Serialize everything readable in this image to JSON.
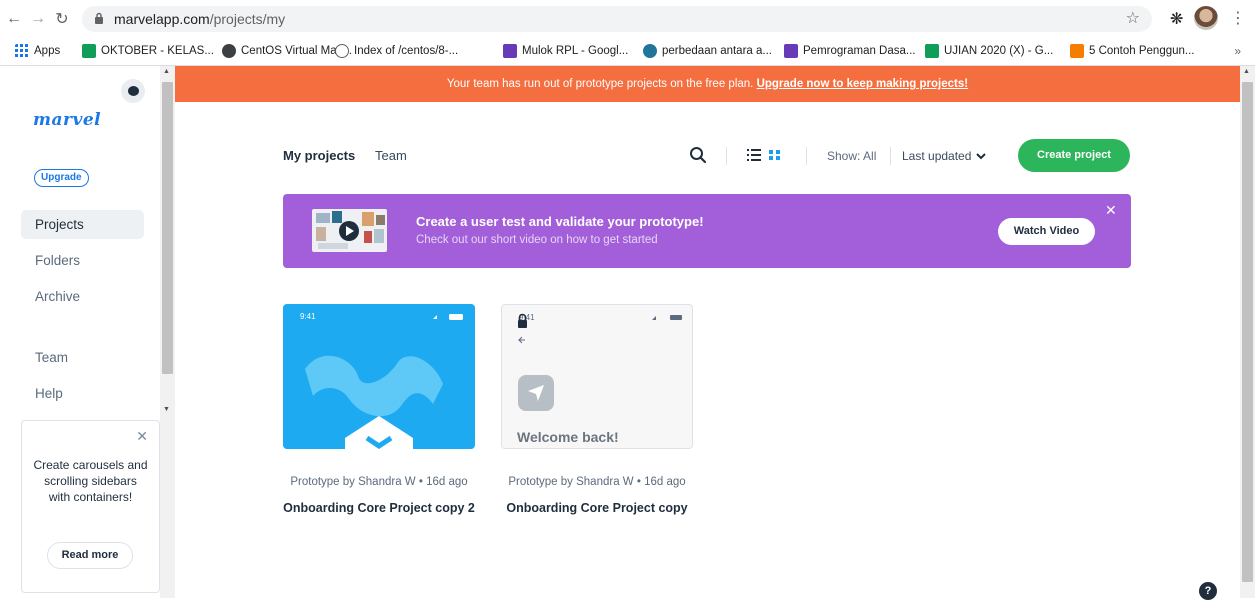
{
  "browser": {
    "url_host": "marvelapp.com",
    "url_path": "/projects/my",
    "bookmarks": [
      {
        "label": "Apps",
        "color": "#1a73e8"
      },
      {
        "label": "OKTOBER - KELAS...",
        "color": "#0f9d58"
      },
      {
        "label": "CentOS Virtual Mac...",
        "color": "#3c4043"
      },
      {
        "label": "Index of /centos/8-...",
        "color": "#5f6368"
      },
      {
        "label": "Mulok RPL - Googl...",
        "color": "#673ab7"
      },
      {
        "label": "perbedaan antara a...",
        "color": "#21759b"
      },
      {
        "label": "Pemrograman Dasa...",
        "color": "#673ab7"
      },
      {
        "label": "UJIAN 2020 (X) - G...",
        "color": "#0f9d58"
      },
      {
        "label": "5 Contoh Penggun...",
        "color": "#f57d00"
      }
    ],
    "more": "»"
  },
  "banner": {
    "text": "Your team has run out of prototype projects on the free plan. ",
    "link": "Upgrade now to keep making projects!"
  },
  "sidebar": {
    "logo": "marvel",
    "upgrade": "Upgrade",
    "items": [
      {
        "label": "Projects"
      },
      {
        "label": "Folders"
      },
      {
        "label": "Archive"
      },
      {
        "label": "Team"
      },
      {
        "label": "Help"
      }
    ],
    "card": {
      "text": "Create carousels and scrolling sidebars with containers!",
      "button": "Read more"
    }
  },
  "toolbar": {
    "tab_my": "My projects",
    "tab_team": "Team",
    "show": "Show: All",
    "sort": "Last updated",
    "create": "Create project"
  },
  "promo": {
    "title": "Create a user test and validate your prototype!",
    "subtitle": "Check out our short video on how to get started",
    "button": "Watch Video"
  },
  "projects": [
    {
      "time": "9:41",
      "meta": "Prototype by Shandra W • 16d ago",
      "title": "Onboarding Core Project copy 2"
    },
    {
      "time": "9:41",
      "meta": "Prototype by Shandra W • 16d ago",
      "title": "Onboarding Core Project copy",
      "welcome": "Welcome back!"
    }
  ],
  "colors": {
    "banner": "#f56e3f",
    "primary": "#1a78e8",
    "create": "#2cb55b",
    "promo": "#a35fd9",
    "card_blue": "#1eaaf1"
  }
}
